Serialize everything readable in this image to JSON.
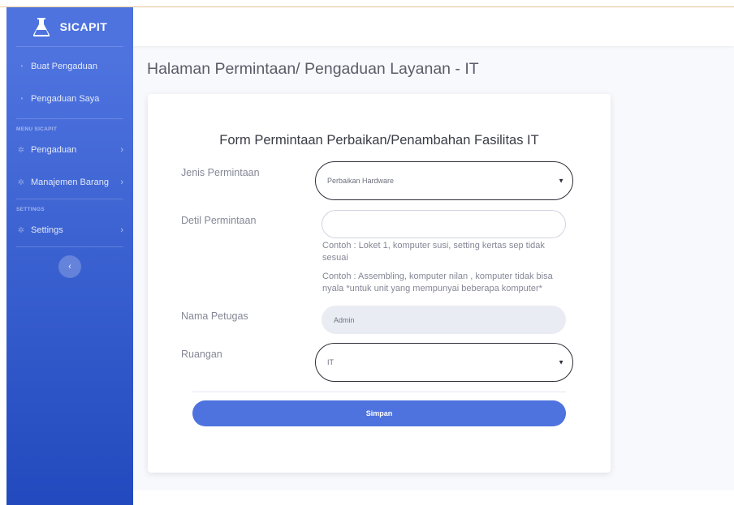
{
  "brand": {
    "name": "SICAPIT",
    "logo_icon": "flask-icon"
  },
  "sidebar": {
    "items_top": [
      {
        "label": "Buat Pengaduan",
        "icon": "dashboard-icon"
      },
      {
        "label": "Pengaduan Saya",
        "icon": "dashboard-icon"
      }
    ],
    "heading_menu": "MENU SICAPIT",
    "items_menu": [
      {
        "label": "Pengaduan",
        "icon": "gear-icon",
        "chevron": "›"
      },
      {
        "label": "Manajemen Barang",
        "icon": "gear-icon",
        "chevron": "›"
      }
    ],
    "heading_settings": "SETTINGS",
    "items_settings": [
      {
        "label": "Settings",
        "icon": "gear-icon",
        "chevron": "›"
      }
    ],
    "toggle_glyph": "‹"
  },
  "page": {
    "title": "Halaman Permintaan/ Pengaduan Layanan - IT"
  },
  "form": {
    "title": "Form Permintaan Perbaikan/Penambahan Fasilitas IT",
    "jenis": {
      "label": "Jenis Permintaan",
      "value": "Perbaikan Hardware"
    },
    "detil": {
      "label": "Detil Permintaan",
      "value": "",
      "help1": "Contoh : Loket 1, komputer susi, setting kertas sep tidak sesuai",
      "help2": "Contoh : Assembling, komputer nilan , komputer tidak bisa nyala *untuk unit yang mempunyai beberapa komputer*"
    },
    "petugas": {
      "label": "Nama Petugas",
      "value": "Admin"
    },
    "ruangan": {
      "label": "Ruangan",
      "value": "IT"
    },
    "submit_label": "Simpan"
  },
  "colors": {
    "sidebar_top": "#4e73df",
    "sidebar_bottom": "#224abe",
    "button": "#4e73df",
    "page_bg": "#f8f9fc"
  }
}
